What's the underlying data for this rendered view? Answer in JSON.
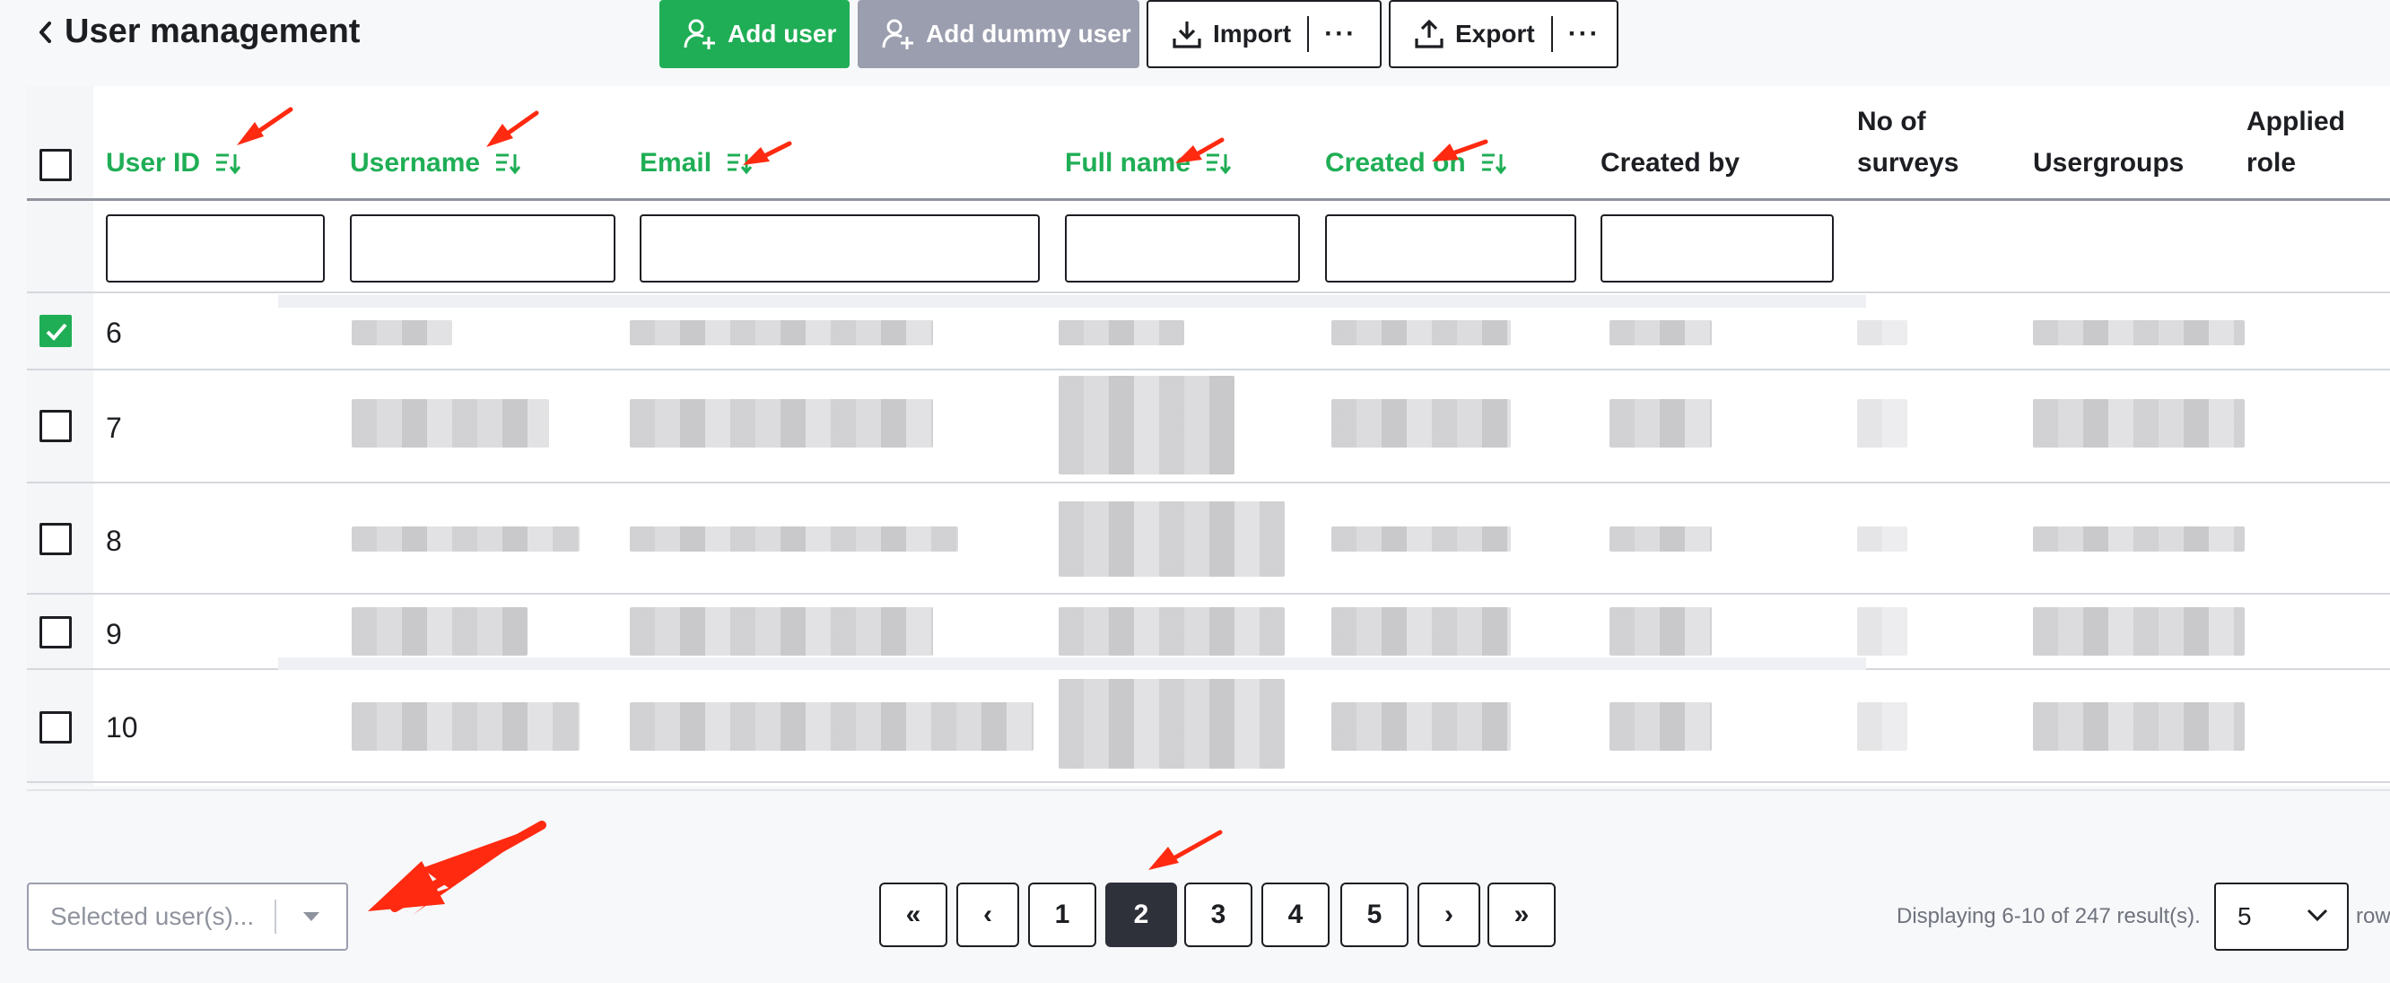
{
  "header": {
    "title": "User management",
    "buttons": {
      "add_user": "Add user",
      "add_dummy_user": "Add dummy user",
      "import": "Import",
      "export": "Export",
      "more": "···"
    }
  },
  "table": {
    "columns": [
      {
        "key": "user_id",
        "label": "User ID",
        "sortable": true
      },
      {
        "key": "username",
        "label": "Username",
        "sortable": true
      },
      {
        "key": "email",
        "label": "Email",
        "sortable": true
      },
      {
        "key": "full_name",
        "label": "Full name",
        "sortable": true
      },
      {
        "key": "created_on",
        "label": "Created on",
        "sortable": true
      },
      {
        "key": "created_by",
        "label": "Created by",
        "sortable": false
      },
      {
        "key": "no_of_surveys",
        "label": [
          "No of",
          "surveys"
        ],
        "sortable": false
      },
      {
        "key": "usergroups",
        "label": "Usergroups",
        "sortable": false
      },
      {
        "key": "applied_role",
        "label": [
          "Applied",
          "role"
        ],
        "sortable": false
      }
    ],
    "rows": [
      {
        "id": "6",
        "checked": true
      },
      {
        "id": "7",
        "checked": false
      },
      {
        "id": "8",
        "checked": false
      },
      {
        "id": "9",
        "checked": false
      },
      {
        "id": "10",
        "checked": false
      }
    ]
  },
  "bulk_action": {
    "placeholder": "Selected user(s)..."
  },
  "pagination": {
    "first": "«",
    "prev": "‹",
    "pages": [
      "1",
      "2",
      "3",
      "4",
      "5"
    ],
    "current": "2",
    "next": "›",
    "last": "»"
  },
  "results": {
    "summary": "Displaying 6-10 of 247 result(s).",
    "rows_per_page": "5",
    "rows_suffix": "rows"
  },
  "colors": {
    "accent_green": "#1fae55",
    "dummy_gray": "#9b9eae",
    "active_page": "#2e313a",
    "annotation_red": "#ff2a10"
  }
}
